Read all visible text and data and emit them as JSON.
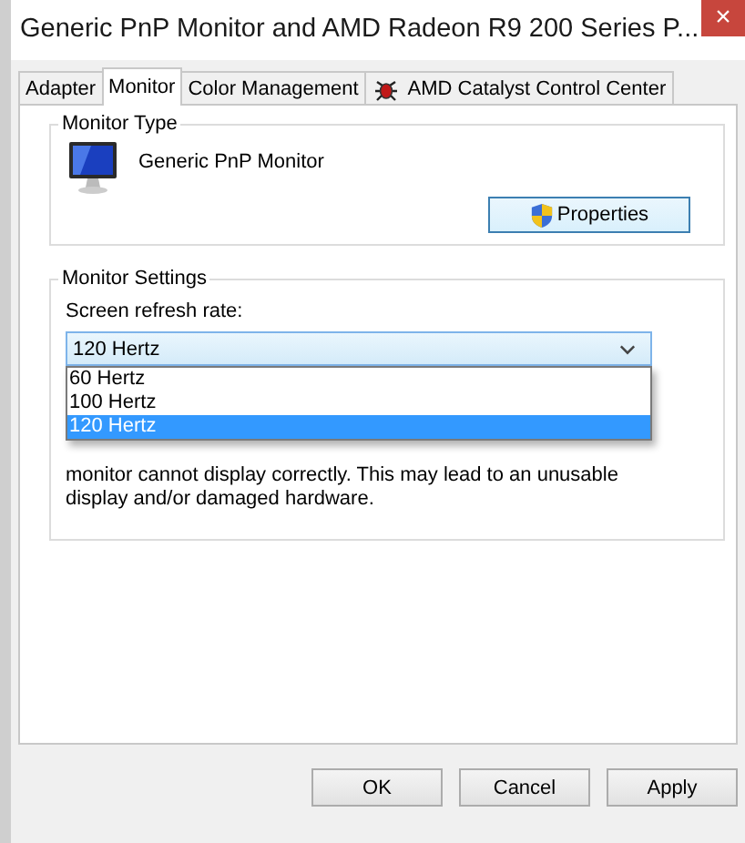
{
  "window": {
    "title": "Generic PnP Monitor and AMD Radeon R9 200 Series P...",
    "close": "×"
  },
  "tabs": [
    {
      "label": "Adapter",
      "selected": false,
      "icon": false
    },
    {
      "label": "Monitor",
      "selected": true,
      "icon": false
    },
    {
      "label": "Color Management",
      "selected": false,
      "icon": false
    },
    {
      "label": "AMD Catalyst Control Center",
      "selected": false,
      "icon": true
    }
  ],
  "monitor_type": {
    "legend": "Monitor Type",
    "name": "Generic PnP Monitor",
    "button": "Properties"
  },
  "monitor_settings": {
    "legend": "Monitor Settings",
    "label": "Screen refresh rate:",
    "value": "120 Hertz",
    "options": [
      {
        "label": "60 Hertz",
        "selected": false
      },
      {
        "label": "100 Hertz",
        "selected": false
      },
      {
        "label": "120 Hertz",
        "selected": true
      }
    ],
    "note": "monitor cannot display correctly. This may lead to an unusable display and/or damaged hardware."
  },
  "buttons": [
    "OK",
    "Cancel",
    "Apply"
  ]
}
